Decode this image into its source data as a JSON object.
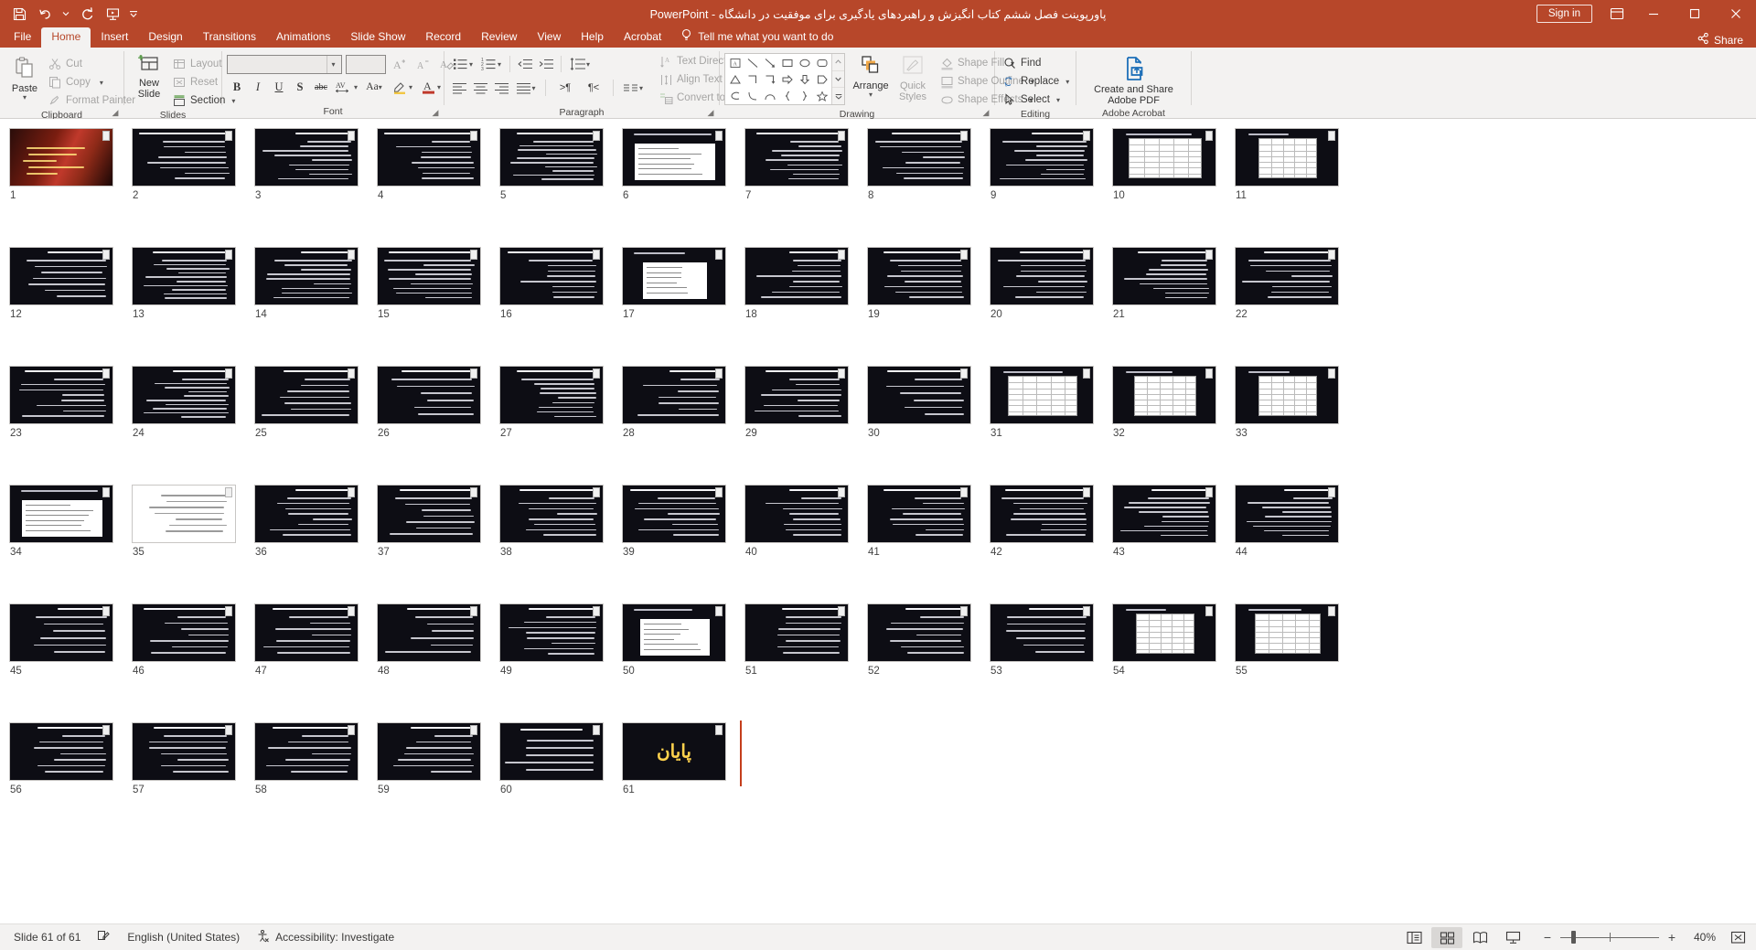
{
  "titlebar": {
    "document_title": "پاورپوینت فصل ششم کتاب انگیزش و راهبردهای یادگیری برای موفقیت در دانشگاه  -  PowerPoint",
    "quick_access": [
      {
        "name": "save-icon",
        "tooltip": "Save"
      },
      {
        "name": "undo-icon",
        "tooltip": "Undo"
      },
      {
        "name": "redo-icon",
        "tooltip": "Redo"
      },
      {
        "name": "start-presentation-icon",
        "tooltip": "Start From Beginning"
      },
      {
        "name": "customize-quick-access-toolbar-icon",
        "tooltip": "Customize Quick Access Toolbar"
      }
    ],
    "sign_in_label": "Sign in",
    "window_buttons": [
      "minimize",
      "restore",
      "close"
    ]
  },
  "tabs": [
    {
      "label": "File",
      "active": false
    },
    {
      "label": "Home",
      "active": true
    },
    {
      "label": "Insert",
      "active": false
    },
    {
      "label": "Design",
      "active": false
    },
    {
      "label": "Transitions",
      "active": false
    },
    {
      "label": "Animations",
      "active": false
    },
    {
      "label": "Slide Show",
      "active": false
    },
    {
      "label": "Record",
      "active": false
    },
    {
      "label": "Review",
      "active": false
    },
    {
      "label": "View",
      "active": false
    },
    {
      "label": "Help",
      "active": false
    },
    {
      "label": "Acrobat",
      "active": false
    }
  ],
  "tell_me": "Tell me what you want to do",
  "share_label": "Share",
  "ribbon": {
    "clipboard": {
      "group_label": "Clipboard",
      "paste_label": "Paste",
      "cut_label": "Cut",
      "copy_label": "Copy",
      "format_painter_label": "Format Painter"
    },
    "slides": {
      "group_label": "Slides",
      "new_slide_label_line1": "New",
      "new_slide_label_line2": "Slide",
      "layout_label": "Layout",
      "reset_label": "Reset",
      "section_label": "Section"
    },
    "font": {
      "group_label": "Font",
      "font_name_value": "",
      "font_size_value": "",
      "bold_label": "B",
      "italic_label": "I",
      "underline_label": "U",
      "shadow_label": "S",
      "strikethrough_label": "abc",
      "character_spacing_label": "AV",
      "change_case_label": "Aa"
    },
    "paragraph": {
      "group_label": "Paragraph",
      "text_direction_label": "Text Direction",
      "align_text_label": "Align Text",
      "convert_to_smartart_label": "Convert to SmartArt"
    },
    "drawing": {
      "group_label": "Drawing",
      "arrange_label": "Arrange",
      "quick_styles_label_line1": "Quick",
      "quick_styles_label_line2": "Styles",
      "shape_fill_label": "Shape Fill",
      "shape_outline_label": "Shape Outline",
      "shape_effects_label": "Shape Effects"
    },
    "editing": {
      "group_label": "Editing",
      "find_label": "Find",
      "replace_label": "Replace",
      "select_label": "Select"
    },
    "acrobat": {
      "group_label": "Adobe Acrobat",
      "create_share_line1": "Create and Share",
      "create_share_line2": "Adobe PDF"
    }
  },
  "slides": [
    {
      "number": "1",
      "type": "title",
      "lines": 0,
      "selected": false
    },
    {
      "number": "2",
      "type": "text",
      "lines": 8,
      "selected": false
    },
    {
      "number": "3",
      "type": "text",
      "lines": 9,
      "selected": false
    },
    {
      "number": "4",
      "type": "text",
      "lines": 8,
      "selected": false
    },
    {
      "number": "5",
      "type": "text",
      "lines": 10,
      "selected": false
    },
    {
      "number": "6",
      "type": "doc",
      "lines": 3,
      "selected": false
    },
    {
      "number": "7",
      "type": "text",
      "lines": 9,
      "selected": false
    },
    {
      "number": "8",
      "type": "text",
      "lines": 8,
      "selected": false
    },
    {
      "number": "9",
      "type": "text",
      "lines": 9,
      "selected": false
    },
    {
      "number": "10",
      "type": "table",
      "lines": 0,
      "selected": false
    },
    {
      "number": "11",
      "type": "table",
      "lines": 0,
      "selected": false
    },
    {
      "number": "12",
      "type": "text",
      "lines": 7,
      "selected": false
    },
    {
      "number": "13",
      "type": "text",
      "lines": 10,
      "selected": false
    },
    {
      "number": "14",
      "type": "text",
      "lines": 9,
      "selected": false
    },
    {
      "number": "15",
      "type": "text",
      "lines": 9,
      "selected": false
    },
    {
      "number": "16",
      "type": "text",
      "lines": 8,
      "selected": false
    },
    {
      "number": "17",
      "type": "doc",
      "lines": 4,
      "selected": false
    },
    {
      "number": "18",
      "type": "text",
      "lines": 8,
      "selected": false
    },
    {
      "number": "19",
      "type": "text",
      "lines": 8,
      "selected": false
    },
    {
      "number": "20",
      "type": "text",
      "lines": 8,
      "selected": false
    },
    {
      "number": "21",
      "type": "text",
      "lines": 9,
      "selected": false
    },
    {
      "number": "22",
      "type": "text",
      "lines": 8,
      "selected": false
    },
    {
      "number": "23",
      "type": "text",
      "lines": 8,
      "selected": false
    },
    {
      "number": "24",
      "type": "text",
      "lines": 10,
      "selected": false
    },
    {
      "number": "25",
      "type": "text",
      "lines": 7,
      "selected": false
    },
    {
      "number": "26",
      "type": "text",
      "lines": 6,
      "selected": false
    },
    {
      "number": "27",
      "type": "text",
      "lines": 9,
      "selected": false
    },
    {
      "number": "28",
      "type": "text",
      "lines": 7,
      "selected": false
    },
    {
      "number": "29",
      "type": "text",
      "lines": 8,
      "selected": false
    },
    {
      "number": "30",
      "type": "text",
      "lines": 6,
      "selected": false
    },
    {
      "number": "31",
      "type": "table",
      "lines": 0,
      "selected": false
    },
    {
      "number": "32",
      "type": "table",
      "lines": 0,
      "selected": false
    },
    {
      "number": "33",
      "type": "table",
      "lines": 0,
      "selected": false
    },
    {
      "number": "34",
      "type": "doc",
      "lines": 0,
      "selected": false
    },
    {
      "number": "35",
      "type": "white",
      "lines": 7,
      "selected": false
    },
    {
      "number": "36",
      "type": "text",
      "lines": 8,
      "selected": false
    },
    {
      "number": "37",
      "type": "text",
      "lines": 7,
      "selected": false
    },
    {
      "number": "38",
      "type": "text",
      "lines": 8,
      "selected": false
    },
    {
      "number": "39",
      "type": "text",
      "lines": 8,
      "selected": false
    },
    {
      "number": "40",
      "type": "text",
      "lines": 8,
      "selected": false
    },
    {
      "number": "41",
      "type": "text",
      "lines": 8,
      "selected": false
    },
    {
      "number": "42",
      "type": "text",
      "lines": 8,
      "selected": false
    },
    {
      "number": "43",
      "type": "text",
      "lines": 9,
      "selected": false
    },
    {
      "number": "44",
      "type": "text",
      "lines": 9,
      "selected": false
    },
    {
      "number": "45",
      "type": "text",
      "lines": 6,
      "selected": false
    },
    {
      "number": "46",
      "type": "text",
      "lines": 7,
      "selected": false
    },
    {
      "number": "47",
      "type": "text",
      "lines": 7,
      "selected": false
    },
    {
      "number": "48",
      "type": "text",
      "lines": 6,
      "selected": false
    },
    {
      "number": "49",
      "type": "text",
      "lines": 8,
      "selected": false
    },
    {
      "number": "50",
      "type": "doc",
      "lines": 0,
      "selected": false
    },
    {
      "number": "51",
      "type": "text",
      "lines": 7,
      "selected": false
    },
    {
      "number": "52",
      "type": "text",
      "lines": 7,
      "selected": false
    },
    {
      "number": "53",
      "type": "text",
      "lines": 6,
      "selected": false
    },
    {
      "number": "54",
      "type": "table",
      "lines": 0,
      "selected": false
    },
    {
      "number": "55",
      "type": "table",
      "lines": 0,
      "selected": false
    },
    {
      "number": "56",
      "type": "text",
      "lines": 7,
      "selected": false
    },
    {
      "number": "57",
      "type": "text",
      "lines": 7,
      "selected": false
    },
    {
      "number": "58",
      "type": "text",
      "lines": 7,
      "selected": false
    },
    {
      "number": "59",
      "type": "text",
      "lines": 7,
      "selected": false
    },
    {
      "number": "60",
      "type": "bullets",
      "lines": 5,
      "selected": false
    },
    {
      "number": "61",
      "type": "end",
      "lines": 0,
      "selected": false,
      "text": "پایان"
    }
  ],
  "statusbar": {
    "slide_counter": "Slide 61 of 61",
    "notes_icon": "notes-icon",
    "language": "English (United States)",
    "accessibility": "Accessibility: Investigate",
    "views": [
      {
        "name": "normal-view",
        "active": false
      },
      {
        "name": "slide-sorter-view",
        "active": true
      },
      {
        "name": "reading-view",
        "active": false
      },
      {
        "name": "slide-show-view",
        "active": false
      }
    ],
    "zoom_percent": "40%",
    "zoom_out_label": "−",
    "zoom_in_label": "+"
  },
  "colors": {
    "accent": "#b7472a",
    "accent_dark": "#c43e1c",
    "ribbon_bg": "#f3f2f1",
    "end_text": "#ffd24d"
  }
}
